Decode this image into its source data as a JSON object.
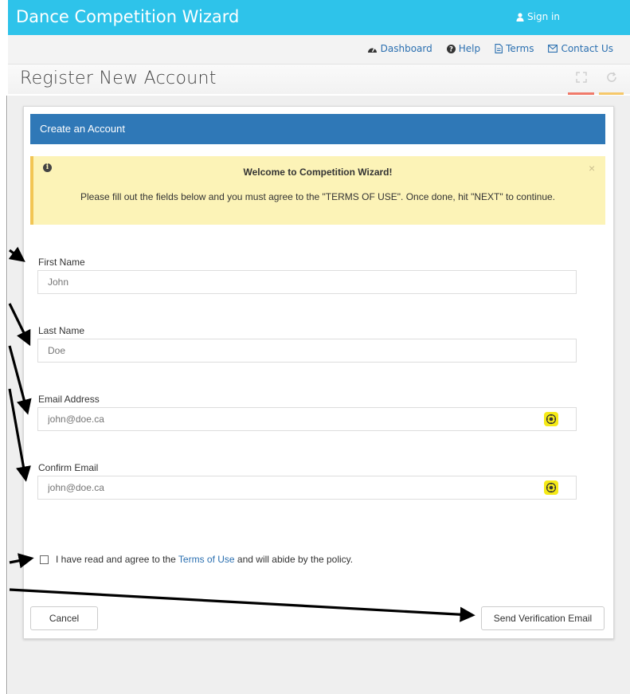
{
  "header": {
    "brand": "Dance Competition Wizard",
    "signin_label": "Sign in"
  },
  "nav": {
    "links": [
      {
        "label": "Dashboard",
        "icon": "dashboard-icon"
      },
      {
        "label": "Help",
        "icon": "question-circle-icon"
      },
      {
        "label": "Terms",
        "icon": "document-icon"
      },
      {
        "label": "Contact Us",
        "icon": "envelope-icon"
      }
    ]
  },
  "page": {
    "title": "Register New Account"
  },
  "panel": {
    "heading": "Create an Account"
  },
  "alert": {
    "title": "Welcome to Competition Wizard!",
    "message": "Please fill out the fields below and you must agree to the \"TERMS OF USE\". Once done, hit \"NEXT\" to continue.",
    "close": "×"
  },
  "form": {
    "first_name": {
      "label": "First Name",
      "placeholder": "John"
    },
    "last_name": {
      "label": "Last Name",
      "placeholder": "Doe"
    },
    "email": {
      "label": "Email Address",
      "placeholder": "john@doe.ca"
    },
    "confirm_email": {
      "label": "Confirm Email",
      "placeholder": "john@doe.ca"
    },
    "agree": {
      "before": "I have read and agree to the ",
      "link": "Terms of Use",
      "after": " and will abide by the policy."
    }
  },
  "buttons": {
    "cancel": "Cancel",
    "send": "Send Verification Email"
  },
  "colors": {
    "topbar": "#2ec3ea",
    "panel_header": "#2f78b7",
    "alert_bg": "#fcf3b7",
    "alert_border": "#f2c554",
    "link": "#2a6fb0",
    "locate_icon_bg": "#f5ea17"
  }
}
